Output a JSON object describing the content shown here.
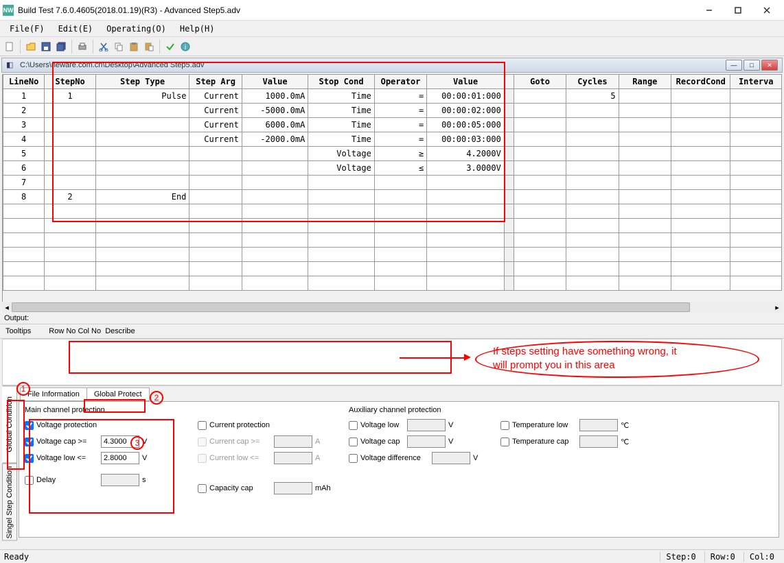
{
  "window": {
    "title": "Build Test  7.6.0.4605(2018.01.19)(R3) - Advanced Step5.adv",
    "app_icon_text": "NW"
  },
  "menus": {
    "file": "File(F)",
    "edit": "Edit(E)",
    "operating": "Operating(O)",
    "help": "Help(H)"
  },
  "doc": {
    "path": "C:\\Users\\neware.com.cn\\Desktop\\Advanced Step5.adv"
  },
  "grid": {
    "headers": {
      "lineno": "LineNo",
      "stepno": "StepNo",
      "steptype": "Step Type",
      "steparg": "Step Arg",
      "value": "Value",
      "stopcond": "Stop Cond",
      "operator": "Operator",
      "value2": "Value",
      "blank": "",
      "goto": "Goto",
      "cycles": "Cycles",
      "range": "Range",
      "recordcond": "RecordCond",
      "interval": "Interva"
    },
    "rows": [
      {
        "lineno": "1",
        "stepno": "1",
        "steptype": "Pulse",
        "steparg": "Current",
        "value": "1000.0mA",
        "stopcond": "Time",
        "operator": "=",
        "value2": "00:00:01:000",
        "goto": "",
        "cycles": "5",
        "range": "",
        "recordcond": "",
        "interval": ""
      },
      {
        "lineno": "2",
        "stepno": "",
        "steptype": "",
        "steparg": "Current",
        "value": "-5000.0mA",
        "stopcond": "Time",
        "operator": "=",
        "value2": "00:00:02:000",
        "goto": "",
        "cycles": "",
        "range": "",
        "recordcond": "",
        "interval": ""
      },
      {
        "lineno": "3",
        "stepno": "",
        "steptype": "",
        "steparg": "Current",
        "value": "6000.0mA",
        "stopcond": "Time",
        "operator": "=",
        "value2": "00:00:05:000",
        "goto": "",
        "cycles": "",
        "range": "",
        "recordcond": "",
        "interval": ""
      },
      {
        "lineno": "4",
        "stepno": "",
        "steptype": "",
        "steparg": "Current",
        "value": "-2000.0mA",
        "stopcond": "Time",
        "operator": "=",
        "value2": "00:00:03:000",
        "goto": "",
        "cycles": "",
        "range": "",
        "recordcond": "",
        "interval": ""
      },
      {
        "lineno": "5",
        "stepno": "",
        "steptype": "",
        "steparg": "",
        "value": "",
        "stopcond": "Voltage",
        "operator": "≥",
        "value2": "4.2000V",
        "goto": "",
        "cycles": "",
        "range": "",
        "recordcond": "",
        "interval": ""
      },
      {
        "lineno": "6",
        "stepno": "",
        "steptype": "",
        "steparg": "",
        "value": "",
        "stopcond": "Voltage",
        "operator": "≤",
        "value2": "3.0000V",
        "goto": "",
        "cycles": "",
        "range": "",
        "recordcond": "",
        "interval": ""
      },
      {
        "lineno": "7",
        "stepno": "",
        "steptype": "",
        "steparg": "",
        "value": "",
        "stopcond": "",
        "operator": "",
        "value2": "",
        "goto": "",
        "cycles": "",
        "range": "",
        "recordcond": "",
        "interval": ""
      },
      {
        "lineno": "8",
        "stepno": "2",
        "steptype": "End",
        "steparg": "",
        "value": "",
        "stopcond": "",
        "operator": "",
        "value2": "",
        "goto": "",
        "cycles": "",
        "range": "",
        "recordcond": "",
        "interval": ""
      },
      {
        "lineno": "",
        "stepno": "",
        "steptype": "",
        "steparg": "",
        "value": "",
        "stopcond": "",
        "operator": "",
        "value2": "",
        "goto": "",
        "cycles": "",
        "range": "",
        "recordcond": "",
        "interval": ""
      }
    ]
  },
  "output_label": "Output:",
  "tooltips": {
    "label": "Tooltips",
    "rowno": "Row No",
    "colno": "Col No",
    "describe": "Describe"
  },
  "vtabs": {
    "global_cond": "Global Condition",
    "single_step": "Singel Step Condition"
  },
  "htabs": {
    "file_info": "File Information",
    "global_protect": "Global Protect"
  },
  "main_prot": {
    "title": "Main channel protection",
    "voltage_protection": "Voltage protection",
    "voltage_cap": "Voltage cap  >=",
    "voltage_cap_val": "4.3000",
    "voltage_cap_unit": "V",
    "voltage_low": "Voltage low  <=",
    "voltage_low_val": "2.8000",
    "voltage_low_unit": "V",
    "delay": "Delay",
    "delay_unit": "s"
  },
  "cur_prot": {
    "current_protection": "Current protection",
    "current_cap": "Current cap  >=",
    "current_cap_unit": "A",
    "current_low": "Current low  <=",
    "current_low_unit": "A",
    "capacity_cap": "Capacity cap",
    "capacity_cap_unit": "mAh"
  },
  "aux_prot": {
    "title": "Auxiliary channel protection",
    "voltage_low": "Voltage low",
    "voltage_cap": "Voltage cap",
    "voltage_diff": "Voltage difference",
    "temp_low": "Temperature low",
    "temp_cap": "Temperature cap",
    "unit_v": "V",
    "unit_c": "℃"
  },
  "status": {
    "ready": "Ready",
    "step": "Step:0",
    "row": "Row:0",
    "col": "Col:0"
  },
  "annotations": {
    "n1": "1",
    "n2": "2",
    "n3": "3",
    "hint1": "If steps setting have something wrong, it",
    "hint2": "will prompt you in this area"
  }
}
